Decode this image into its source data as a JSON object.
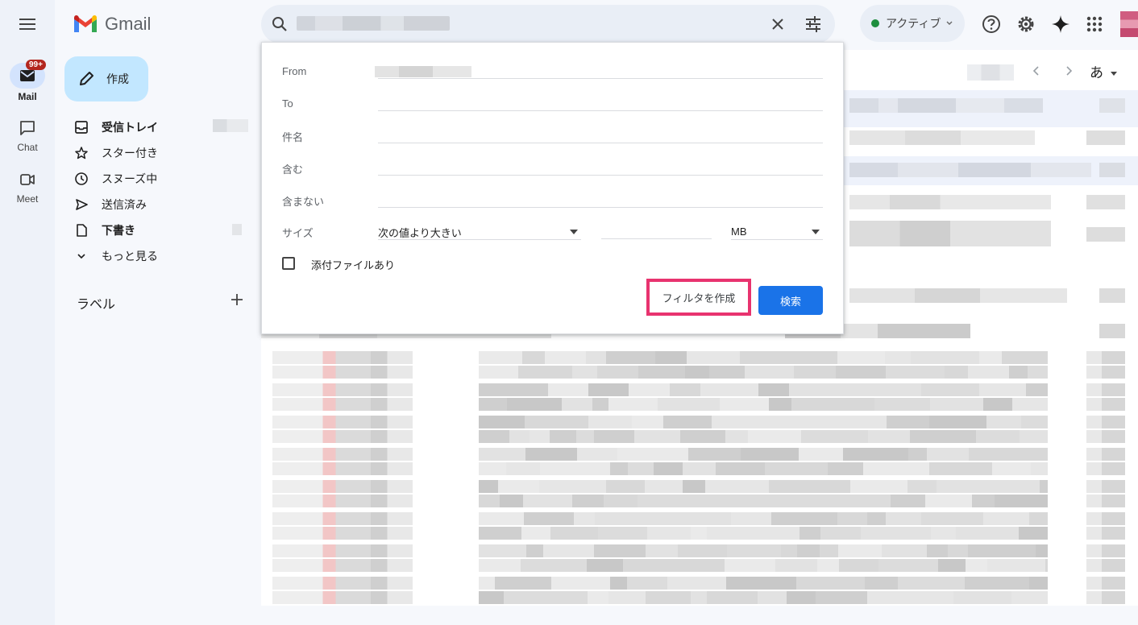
{
  "app": {
    "name": "Gmail"
  },
  "rail": {
    "mail": {
      "label": "Mail",
      "badge": "99+"
    },
    "chat": {
      "label": "Chat"
    },
    "meet": {
      "label": "Meet"
    }
  },
  "header": {
    "status_label": "アクティブ",
    "status_color": "#1e8e3e"
  },
  "sidebar": {
    "compose_label": "作成",
    "items": [
      {
        "label": "受信トレイ",
        "icon": "inbox-icon",
        "bold": true
      },
      {
        "label": "スター付き",
        "icon": "star-icon",
        "bold": false
      },
      {
        "label": "スヌーズ中",
        "icon": "clock-icon",
        "bold": false
      },
      {
        "label": "送信済み",
        "icon": "send-icon",
        "bold": false
      },
      {
        "label": "下書き",
        "icon": "draft-icon",
        "bold": true
      },
      {
        "label": "もっと見る",
        "icon": "chevron-down-icon",
        "bold": false
      }
    ],
    "labels_title": "ラベル"
  },
  "list": {
    "input_tool_label": "あ"
  },
  "search_options": {
    "from_label": "From",
    "to_label": "To",
    "subject_label": "件名",
    "has_words_label": "含む",
    "doesnt_have_label": "含まない",
    "size_label": "サイズ",
    "size_operator": "次の値より大きい",
    "size_unit": "MB",
    "has_attachment_label": "添付ファイルあり",
    "create_filter_label": "フィルタを作成",
    "search_button_label": "検索",
    "highlight_color": "#e8336f",
    "search_button_color": "#1a73e8"
  }
}
